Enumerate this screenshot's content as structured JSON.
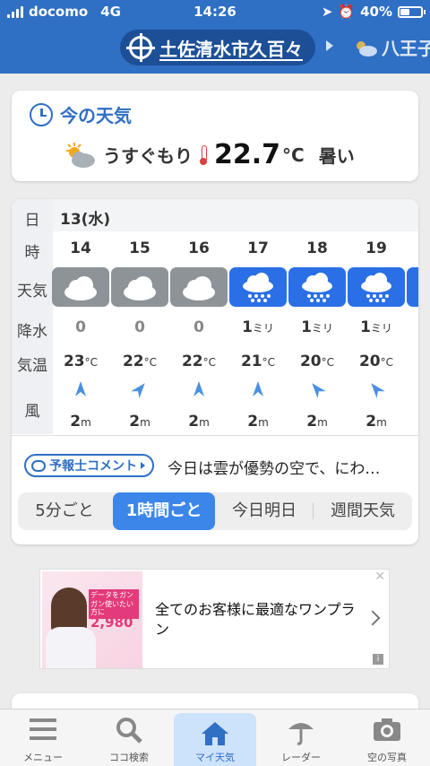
{
  "status": {
    "carrier": "docomo",
    "network": "4G",
    "time": "14:26",
    "battery": "40%"
  },
  "header": {
    "location": "土佐清水市久百々",
    "next_location": "八王子"
  },
  "now": {
    "title": "今の天気",
    "condition": "うすぐもり",
    "temperature": "22.7",
    "unit": "°C",
    "feel": "暑い"
  },
  "hourly": {
    "row_labels": {
      "date": "日",
      "hour": "時",
      "weather": "天気",
      "precip": "降水",
      "temp": "気温",
      "wind": "風"
    },
    "date": "13(水)",
    "hours": [
      {
        "hour": "14",
        "weather": "cloud",
        "precip": "0",
        "precip_unit": "",
        "temp": "23",
        "wind_dir": "north",
        "wind": "2",
        "wind_unit": "m"
      },
      {
        "hour": "15",
        "weather": "cloud",
        "precip": "0",
        "precip_unit": "",
        "temp": "22",
        "wind_dir": "northeast",
        "wind": "2",
        "wind_unit": "m"
      },
      {
        "hour": "16",
        "weather": "cloud",
        "precip": "0",
        "precip_unit": "",
        "temp": "22",
        "wind_dir": "north",
        "wind": "2",
        "wind_unit": "m"
      },
      {
        "hour": "17",
        "weather": "rain",
        "precip": "1",
        "precip_unit": "ミリ",
        "temp": "21",
        "wind_dir": "north",
        "wind": "2",
        "wind_unit": "m"
      },
      {
        "hour": "18",
        "weather": "rain",
        "precip": "1",
        "precip_unit": "ミリ",
        "temp": "20",
        "wind_dir": "northwest",
        "wind": "2",
        "wind_unit": "m"
      },
      {
        "hour": "19",
        "weather": "rain",
        "precip": "1",
        "precip_unit": "ミリ",
        "temp": "20",
        "wind_dir": "northwest",
        "wind": "2",
        "wind_unit": "m"
      }
    ],
    "temp_unit": "°C",
    "comment_button": "予報士コメント",
    "comment_text": "今日は雲が優勢の空で、にわ…",
    "tabs": [
      "5分ごと",
      "1時間ごと",
      "今日明日",
      "週間天気"
    ],
    "active_tab": 1
  },
  "ad": {
    "tag": "データをガンガン使いたい方に",
    "price": "2,980",
    "text": "全てのお客様に最適なワンプラン"
  },
  "nav": [
    {
      "label": "メニュー",
      "icon": "menu-icon"
    },
    {
      "label": "ココ検索",
      "icon": "search-icon"
    },
    {
      "label": "マイ天気",
      "icon": "home-icon"
    },
    {
      "label": "レーダー",
      "icon": "umbrella-icon"
    },
    {
      "label": "空の写真",
      "icon": "camera-icon"
    }
  ],
  "colors": {
    "brand": "#2f6fc4",
    "rain": "#2a6fe6",
    "cloud": "#8e9397",
    "active_tab": "#3c86ea"
  }
}
